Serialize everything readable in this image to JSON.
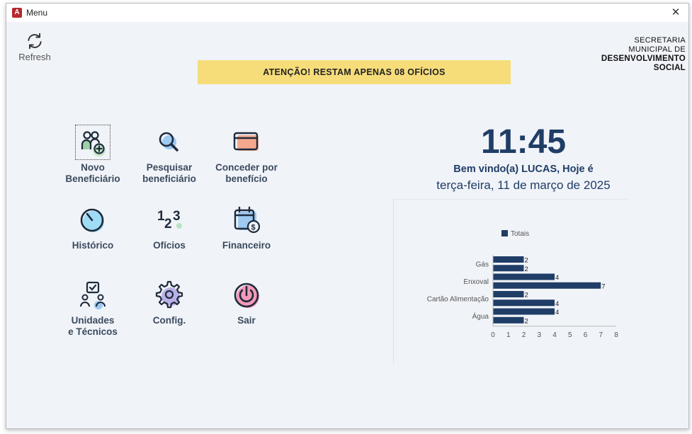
{
  "window": {
    "title": "Menu",
    "app_icon_letter": "A",
    "close_glyph": "✕"
  },
  "toolbar": {
    "refresh_label": "Refresh"
  },
  "logo": {
    "line1": "SECRETARIA",
    "line2": "MUNICIPAL DE",
    "line3": "DESENVOLVIMENTO",
    "line4": "SOCIAL"
  },
  "alert": {
    "text": "ATENÇÃO! RESTAM APENAS 08 OFÍCIOS"
  },
  "menu": {
    "novo": "Novo\nBeneficiário",
    "pesquisar": "Pesquisar\nbeneficiário",
    "conceder": "Conceder por\nbenefício",
    "historico": "Histórico",
    "oficios": "Ofícios",
    "financeiro": "Financeiro",
    "unidades": "Unidades\ne Técnicos",
    "config": "Config.",
    "sair": "Sair"
  },
  "dashboard": {
    "time": "11:45",
    "welcome": "Bem vindo(a) LUCAS, Hoje é",
    "date": "terça-feira, 11 de março de 2025"
  },
  "colors": {
    "bar": "#1f3d66",
    "alert_bg": "#f6dd7a",
    "text_dark": "#1f3d66"
  },
  "chart_data": {
    "type": "bar",
    "orientation": "horizontal",
    "legend": [
      "Totais"
    ],
    "legend_position": "top-left",
    "category_labels": [
      "Gás",
      "Enxoval",
      "Cartão Alimentação",
      "Água"
    ],
    "values": [
      2,
      2,
      4,
      7,
      2,
      4,
      4,
      2
    ],
    "xlim": [
      0,
      8
    ],
    "xticks": [
      "0",
      "1",
      "2",
      "3",
      "4",
      "5",
      "6",
      "7",
      "8"
    ],
    "grid": false
  }
}
